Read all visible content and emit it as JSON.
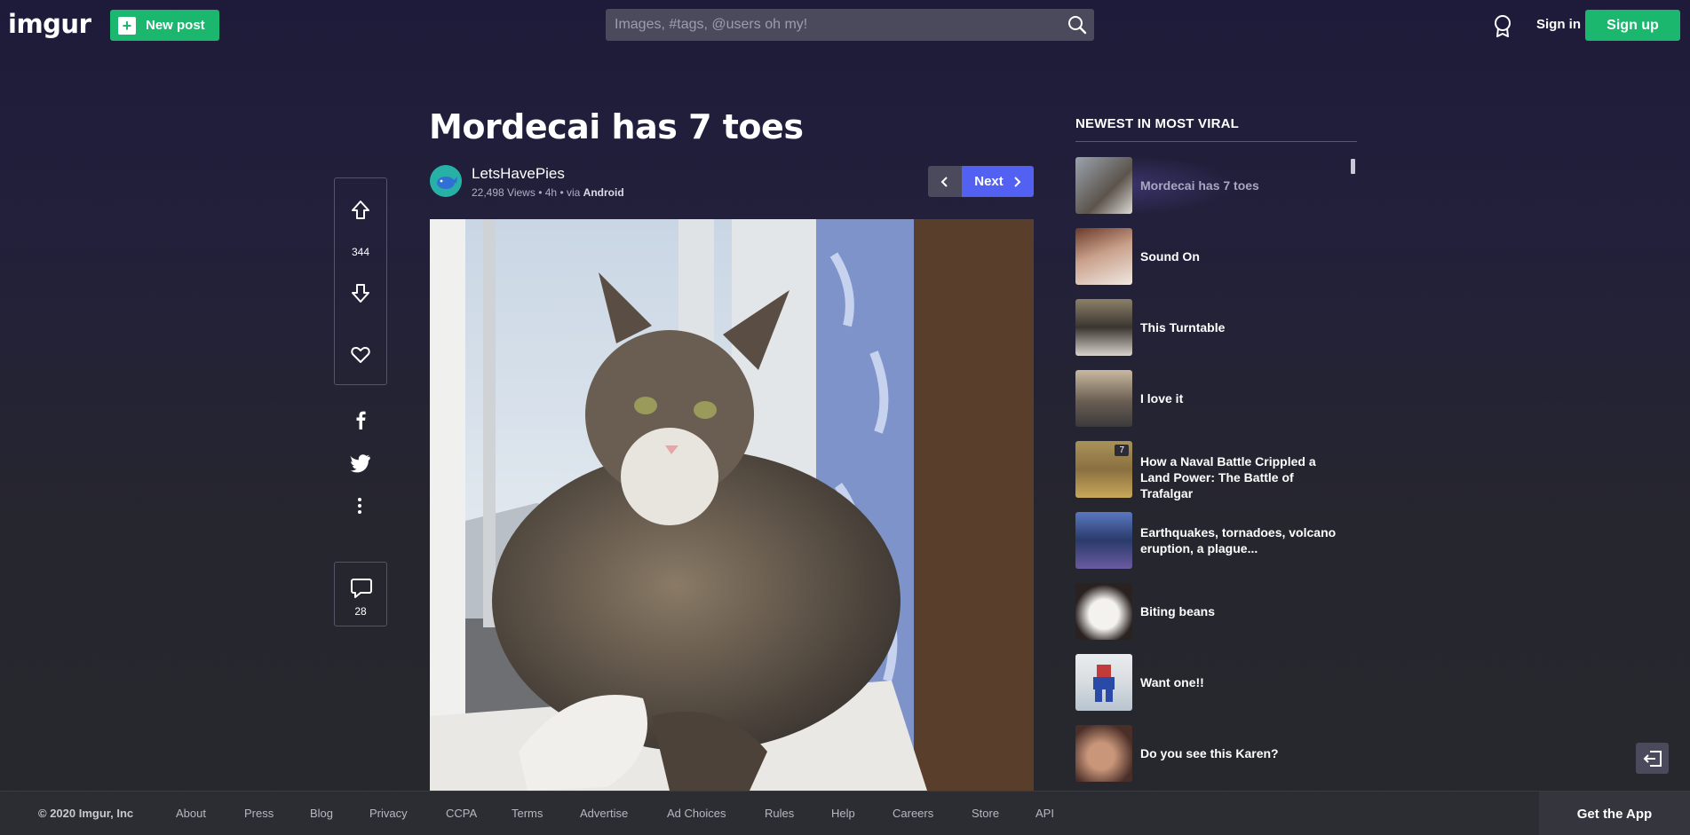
{
  "header": {
    "logo": "imgur",
    "new_post_label": "New post",
    "search_placeholder": "Images, #tags, @users oh my!",
    "sign_in": "Sign in",
    "sign_up": "Sign up"
  },
  "post": {
    "title": "Mordecai has 7 toes",
    "author": "LetsHavePies",
    "views": "22,498 Views",
    "age": "4h",
    "via_prefix": "via",
    "platform": "Android",
    "next_label": "Next",
    "score": "344",
    "comments": "28",
    "image_desc": "tabby cat on windowsill"
  },
  "sidebar": {
    "title": "NEWEST IN MOST VIRAL",
    "items": [
      {
        "title": "Mordecai has 7 toes",
        "active": true
      },
      {
        "title": "Sound On"
      },
      {
        "title": "This Turntable"
      },
      {
        "title": "I love it"
      },
      {
        "title": "How a Naval Battle Crippled a Land Power: The Battle of Trafalgar",
        "badge": "7"
      },
      {
        "title": "Earthquakes, tornadoes, volcano eruption, a plague..."
      },
      {
        "title": "Biting beans"
      },
      {
        "title": "Want one!!"
      },
      {
        "title": "Do you see this Karen?"
      }
    ]
  },
  "footer": {
    "copyright": "© 2020 Imgur, Inc",
    "links": [
      "About",
      "Press",
      "Blog",
      "Privacy",
      "CCPA",
      "Terms",
      "Advertise",
      "Ad Choices",
      "Rules",
      "Help",
      "Careers",
      "Store",
      "API"
    ],
    "get_app": "Get the App"
  },
  "colors": {
    "brand_green": "#1bb76e",
    "next_blue": "#5361f2"
  }
}
